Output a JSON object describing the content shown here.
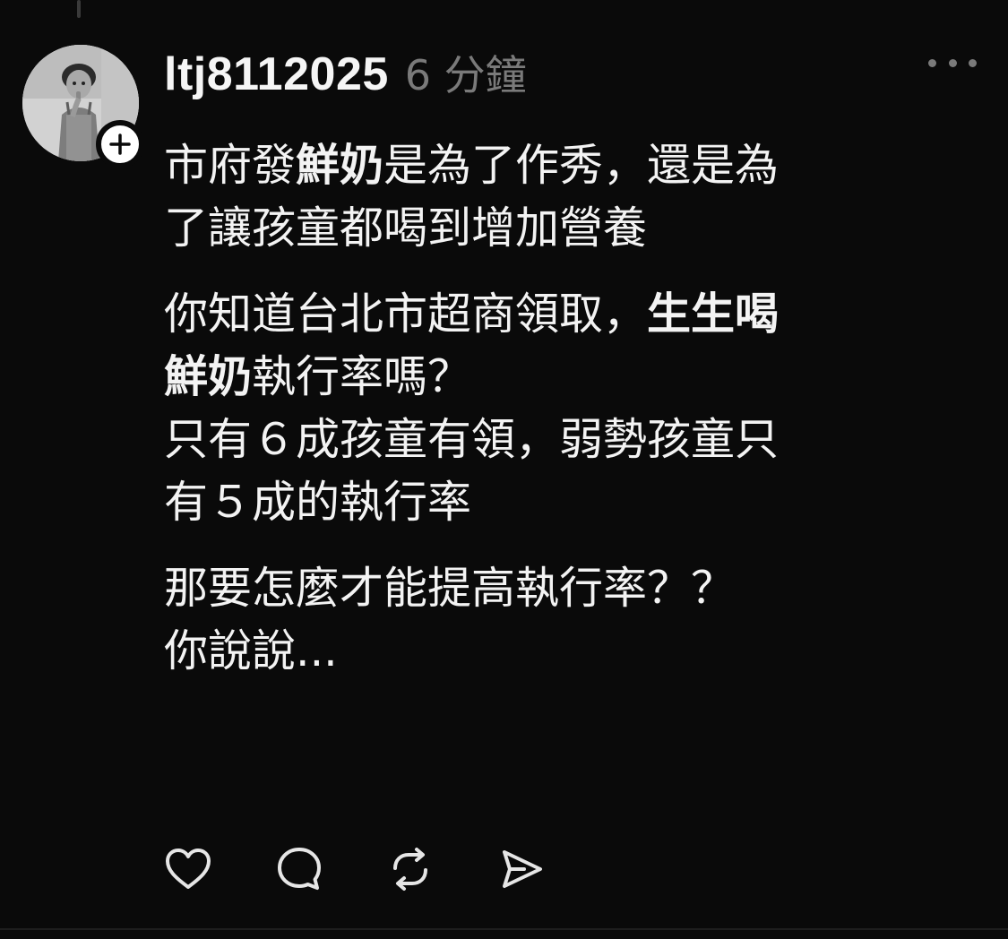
{
  "post": {
    "username": "ltj8112025",
    "timestamp": "6 分鐘",
    "paragraphs": [
      {
        "lines": [
          [
            {
              "text": "市府發",
              "bold": false
            },
            {
              "text": "鮮奶",
              "bold": true
            },
            {
              "text": "是為了作秀，還是為",
              "bold": false
            }
          ],
          [
            {
              "text": "了讓孩童都喝到增加營養",
              "bold": false
            }
          ]
        ]
      },
      {
        "lines": [
          [
            {
              "text": "你知道台北市超商領取，",
              "bold": false
            },
            {
              "text": "生生喝",
              "bold": true
            }
          ],
          [
            {
              "text": "鮮奶",
              "bold": true
            },
            {
              "text": "執行率嗎？",
              "bold": false
            }
          ],
          [
            {
              "text": "只有６成孩童有領，弱勢孩童只",
              "bold": false
            }
          ],
          [
            {
              "text": "有５成的執行率",
              "bold": false
            }
          ]
        ]
      },
      {
        "lines": [
          [
            {
              "text": "那要怎麼才能提高執行率？？",
              "bold": false
            }
          ],
          [
            {
              "text": "你說說...",
              "bold": false
            }
          ]
        ]
      }
    ]
  },
  "icons": {
    "follow": "plus-icon",
    "more": "more-horizontal-icon",
    "like": "heart-icon",
    "reply": "speech-bubble-icon",
    "repost": "repost-icon",
    "share": "send-icon"
  },
  "colors": {
    "background": "#0a0a0a",
    "text": "#f3f3f3",
    "muted": "#7a7a7a",
    "badge": "#ffffff"
  }
}
